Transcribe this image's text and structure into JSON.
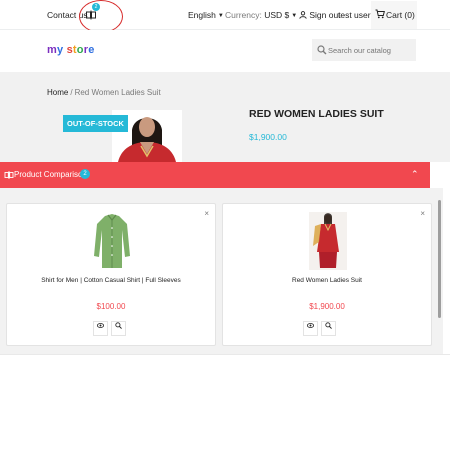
{
  "topbar": {
    "contact_label": "Contact us",
    "compare_count": "2",
    "language": "English",
    "currency_label": "Currency:",
    "currency_value": "USD $",
    "signout_label": "Sign out",
    "user_name": "test user",
    "cart_label": "Cart (0)"
  },
  "header": {
    "logo": "my store",
    "search_placeholder": "Search our catalog"
  },
  "breadcrumb": {
    "home": "Home",
    "separator": "/",
    "current": "Red Women Ladies Suit"
  },
  "product": {
    "flag": "OUT-OF-STOCK",
    "title": "RED WOMEN LADIES SUIT",
    "price": "$1,900.00"
  },
  "comparison": {
    "title": "Product Comparison",
    "count": "2",
    "items": [
      {
        "name": "Shirt for Men | Cotton Casual Shirt | Full Sleeves",
        "price": "$100.00",
        "remove": "×",
        "view_icon": "eye-icon",
        "zoom_icon": "zoom-icon"
      },
      {
        "name": "Red Women Ladies Suit",
        "price": "$1,900.00",
        "remove": "×",
        "view_icon": "eye-icon",
        "zoom_icon": "zoom-icon"
      }
    ]
  },
  "colors": {
    "accent": "#25b9d7",
    "comparison_bar": "#f1484f",
    "price_red": "#f1484f",
    "annotation": "#d72a2a"
  }
}
